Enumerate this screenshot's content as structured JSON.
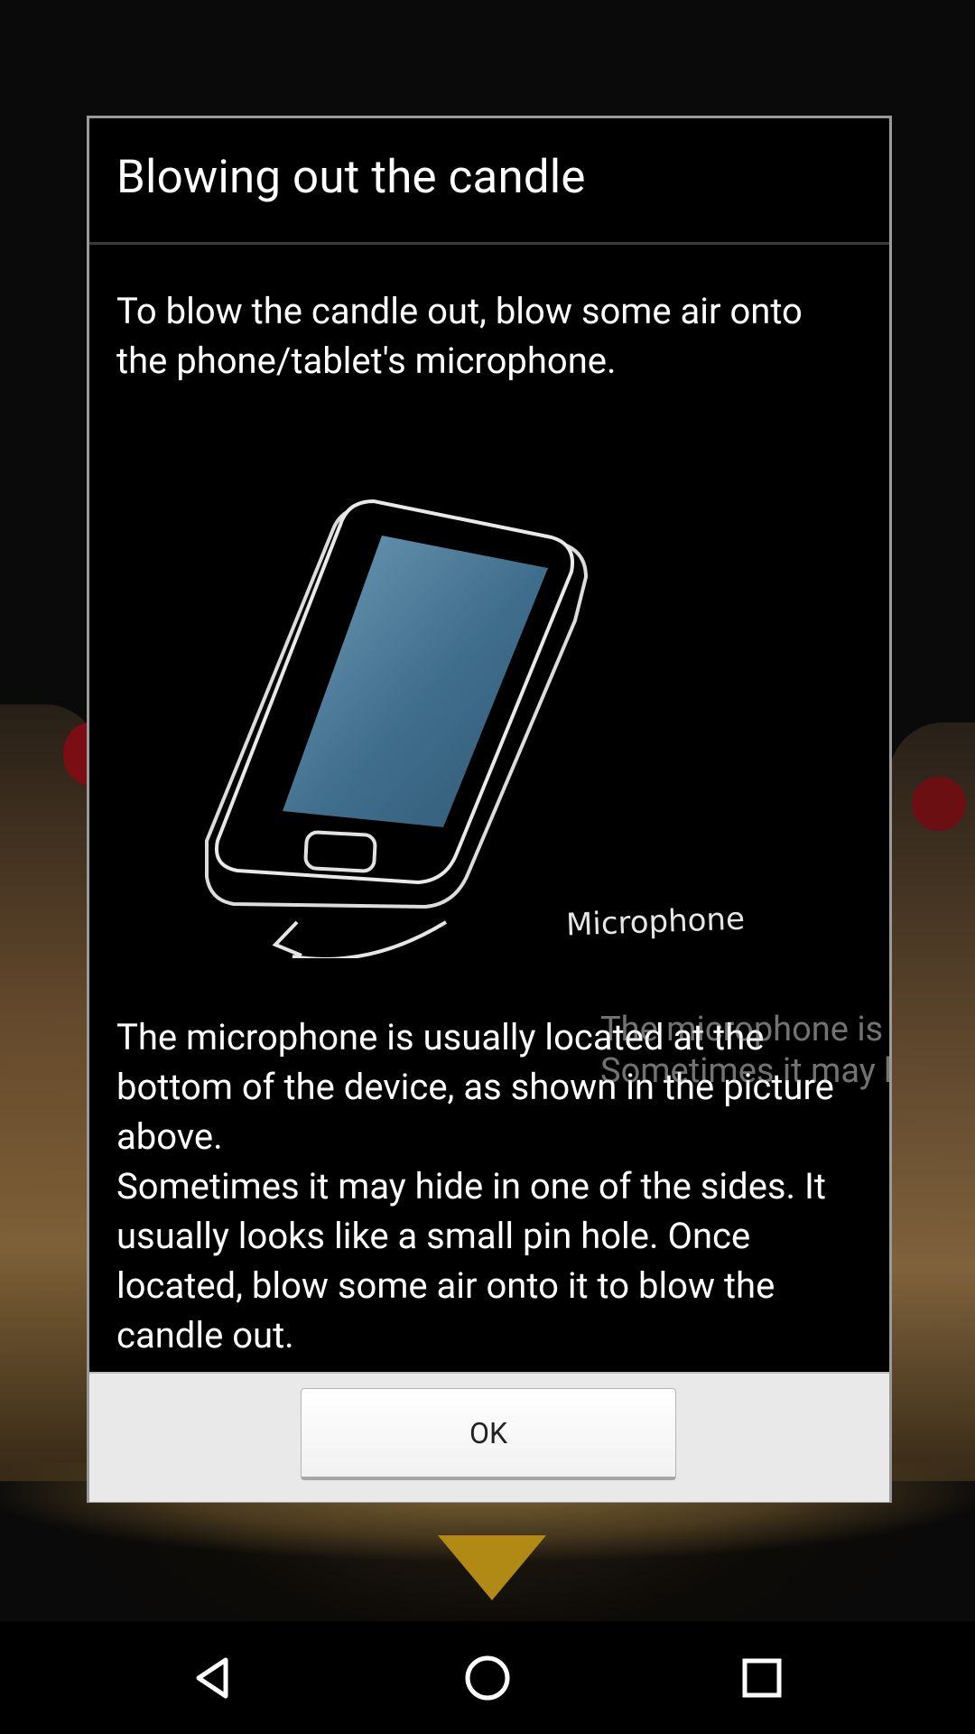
{
  "dialog": {
    "title": "Blowing out the candle",
    "intro": "To blow the candle out, blow some air onto the phone/tablet's microphone.",
    "illustration_label": "Microphone",
    "body_line1": "The microphone is usually located at the bottom of the device, as shown in the picture above.",
    "body_line2": "Sometimes it may hide in one of the sides. It usually looks like a small pin hole. Once located, blow some air onto it to blow the candle out.",
    "ghost_line1": "The microphone is usu",
    "ghost_line2": "Sometimes it may hid",
    "ok_label": "OK"
  },
  "navbar": {
    "back_icon": "back-triangle-icon",
    "home_icon": "home-circle-icon",
    "recent_icon": "recent-apps-square-icon"
  },
  "colors": {
    "dialog_bg": "#000000",
    "button_bar_bg": "#e9e9e9",
    "text": "#ffffff"
  }
}
